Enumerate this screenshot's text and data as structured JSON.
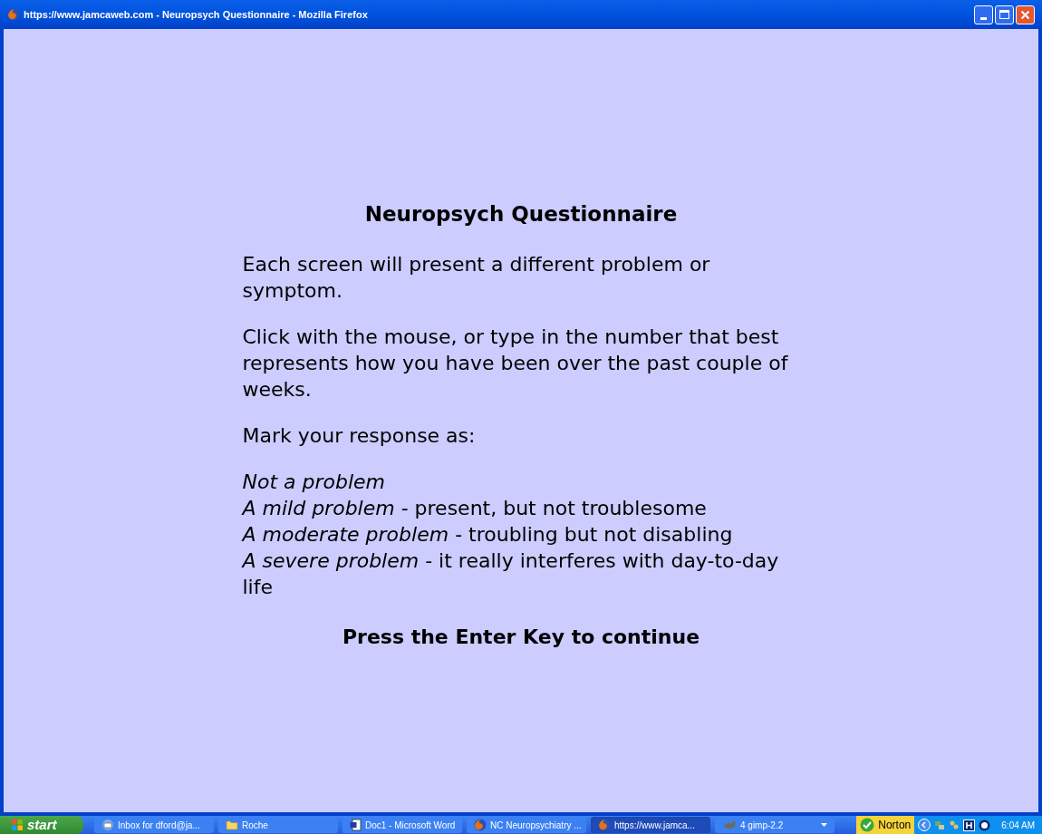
{
  "window": {
    "title": "https://www.jamcaweb.com - Neuropsych Questionnaire - Mozilla Firefox"
  },
  "page": {
    "heading": "Neuropsych Questionnaire",
    "paragraphs": [
      "Each screen will present a different problem or symptom.",
      "Click with the mouse, or type in the number that best represents how you have been over the past couple of weeks.",
      "Mark your response as:"
    ],
    "responses": [
      {
        "label": "Not a problem"
      },
      {
        "label": "A mild problem",
        "description": "- present, but not troublesome"
      },
      {
        "label": "A moderate problem",
        "description": "- troubling but not disabling"
      },
      {
        "label": "A severe problem",
        "description": "- it really interferes with day-to-day life"
      }
    ],
    "prompt": "Press the Enter Key to continue"
  },
  "taskbar": {
    "start": "start",
    "buttons": [
      {
        "label": "Inbox for dford@ja...",
        "kind": "mail",
        "selected": false
      },
      {
        "label": "Roche",
        "kind": "folder",
        "selected": false
      },
      {
        "label": "Doc1 - Microsoft Word",
        "kind": "word",
        "selected": false
      },
      {
        "label": "NC Neuropsychiatry ...",
        "kind": "firefox",
        "selected": false
      },
      {
        "label": "https://www.jamca...",
        "kind": "firefox",
        "selected": true
      },
      {
        "label": "4  gimp-2.2",
        "kind": "gimp",
        "selected": false,
        "grouped": true
      }
    ],
    "norton": "Norton",
    "clock": "6:04 AM"
  }
}
